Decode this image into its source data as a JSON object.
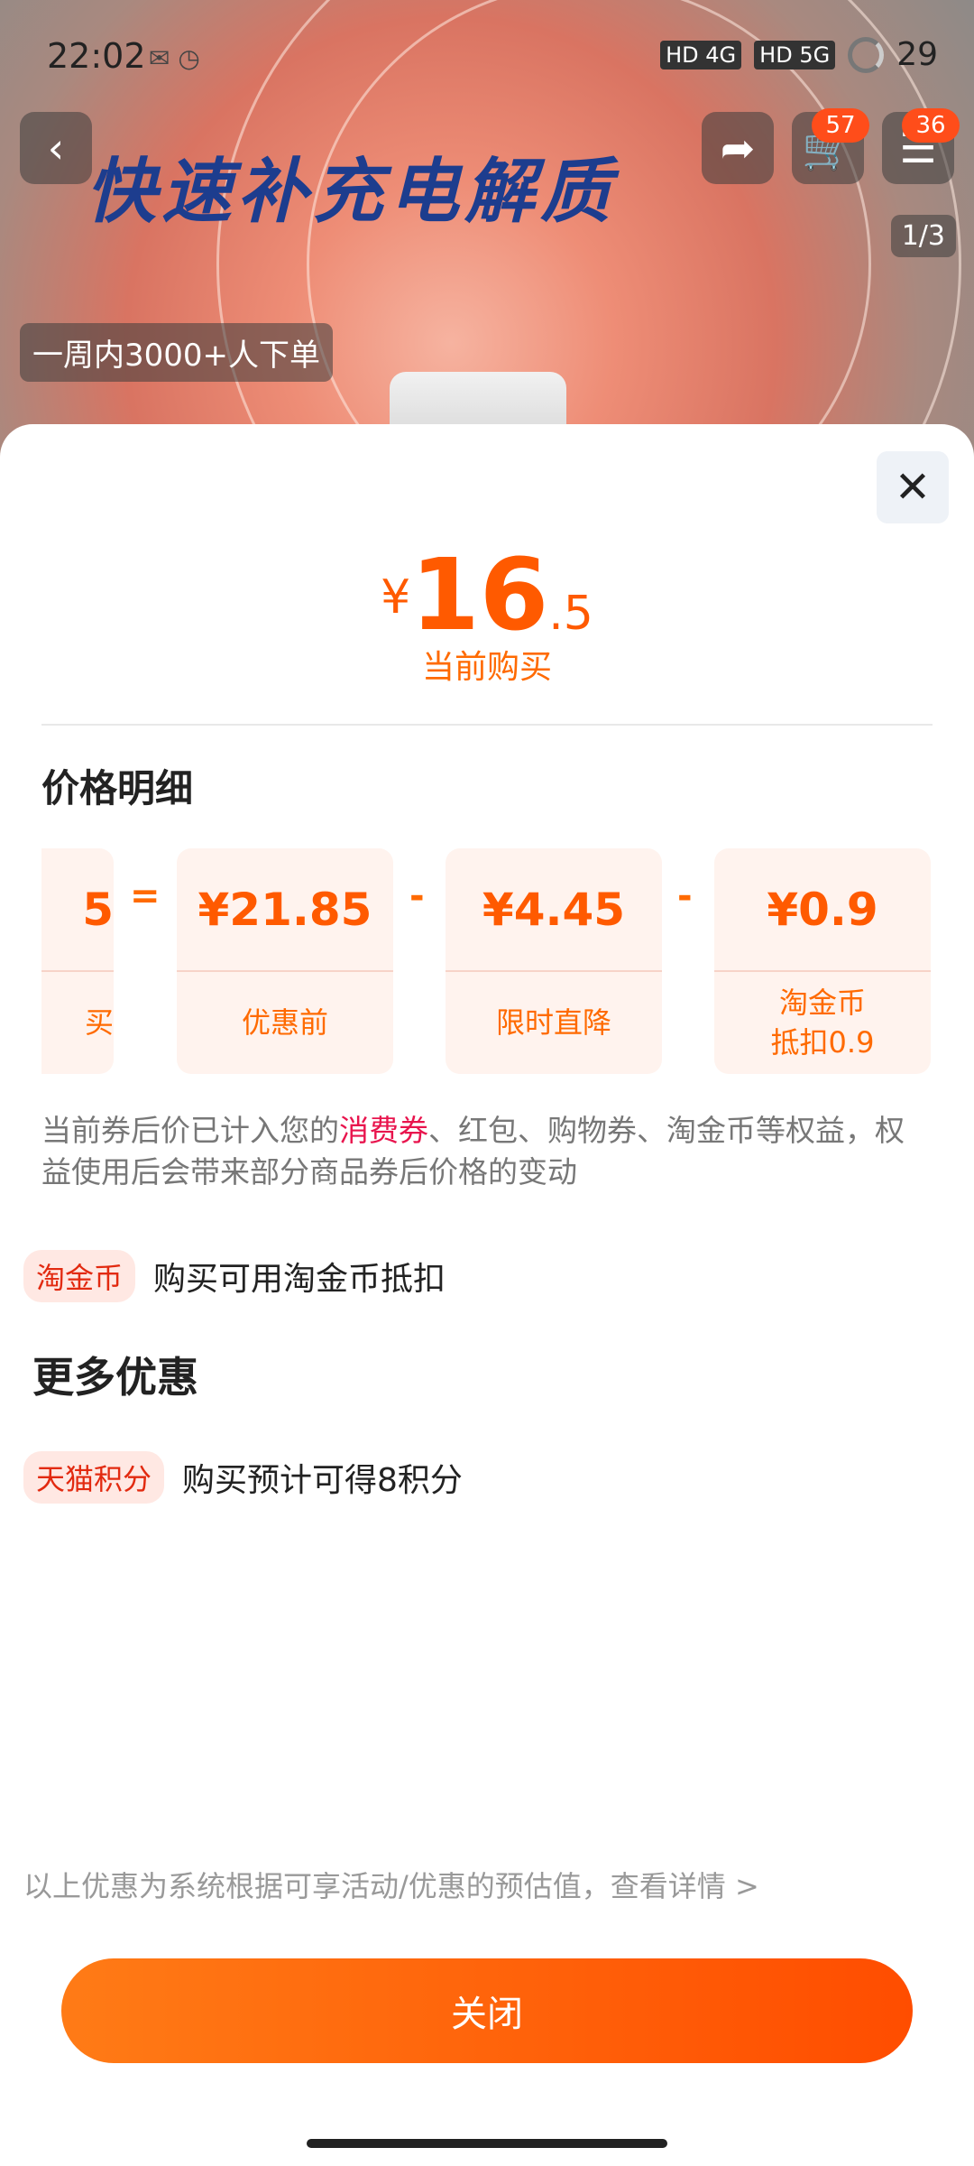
{
  "status_bar": {
    "time": "22:02",
    "network_1": "HD 4G",
    "network_2": "HD 5G",
    "battery": "29"
  },
  "hero": {
    "title": "快速补充电解质",
    "orders_text": "一周内3000+人下单",
    "page_indicator": "1/3",
    "cart_badge": "57",
    "msg_badge": "36"
  },
  "sheet": {
    "price": {
      "yen": "¥",
      "int": "16",
      "dec": ".5"
    },
    "price_label": "当前购买",
    "section_title": "价格明细",
    "breakdown": [
      {
        "value": "5",
        "label": "买"
      },
      {
        "value": "¥21.85",
        "label": "优惠前"
      },
      {
        "value": "¥4.45",
        "label": "限时直降"
      },
      {
        "value": "¥0.9",
        "label": "淘金币\n抵扣0.9"
      }
    ],
    "operators": [
      "=",
      "-",
      "-"
    ],
    "notice_prefix": "当前券后价已计入您的",
    "notice_highlight": "消费券",
    "notice_suffix": "、红包、购物券、淘金币等权益，权益使用后会带来部分商品券后价格的变动",
    "coin_tag": "淘金币",
    "coin_text": "购买可用淘金币抵扣",
    "more_title": "更多优惠",
    "points_tag": "天猫积分",
    "points_text": "购买预计可得8积分",
    "footer_note": "以上优惠为系统根据可享活动/优惠的预估值，查看详情 >",
    "close_label": "关闭"
  },
  "icons": {
    "back": "back-chevron-icon",
    "share": "share-icon",
    "cart": "cart-icon",
    "close": "close-icon"
  }
}
